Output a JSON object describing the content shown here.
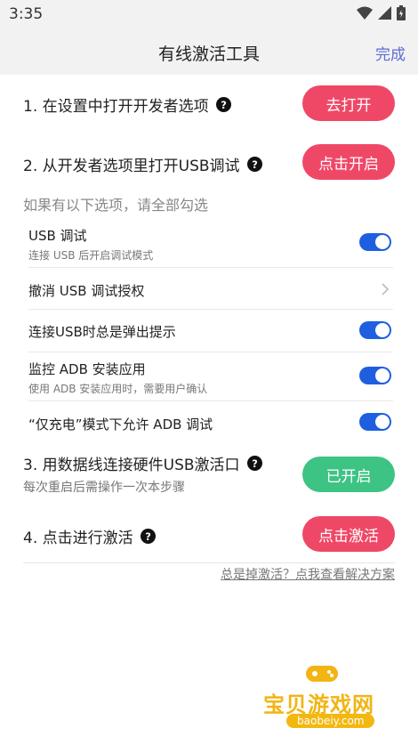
{
  "status": {
    "time": "3:35"
  },
  "header": {
    "title": "有线激活工具",
    "done_label": "完成"
  },
  "steps": [
    {
      "label": "1. 在设置中打开开发者选项",
      "button": "去打开"
    },
    {
      "label": "2. 从开发者选项里打开USB调试",
      "button": "点击开启"
    },
    {
      "label": "3. 用数据线连接硬件USB激活口",
      "sub": "每次重启后需操作一次本步骤",
      "button": "已开启"
    },
    {
      "label": "4. 点击进行激活",
      "button": "点击激活"
    }
  ],
  "hint": "如果有以下选项，请全部勾选",
  "options": [
    {
      "title": "USB 调试",
      "sub": "连接 USB 后开启调试模式",
      "control": "toggle",
      "on": true
    },
    {
      "title": "撤消 USB 调试授权",
      "control": "chevron"
    },
    {
      "title": "连接USB时总是弹出提示",
      "control": "toggle",
      "on": true
    },
    {
      "title": "监控 ADB 安装应用",
      "sub": "使用 ADB 安装应用时，需要用户确认",
      "control": "toggle",
      "on": true
    },
    {
      "title": "“仅充电”模式下允许 ADB 调试",
      "control": "toggle",
      "on": true
    }
  ],
  "trouble_link": "总是掉激活？点我查看解决方案",
  "watermark": {
    "cn": "宝贝游戏网",
    "en": "baobeiy.com"
  },
  "colors": {
    "accent_red": "#ef4867",
    "accent_green": "#3dc383",
    "toggle_blue": "#1e5fe0",
    "link_blue": "#5f6bd6"
  }
}
